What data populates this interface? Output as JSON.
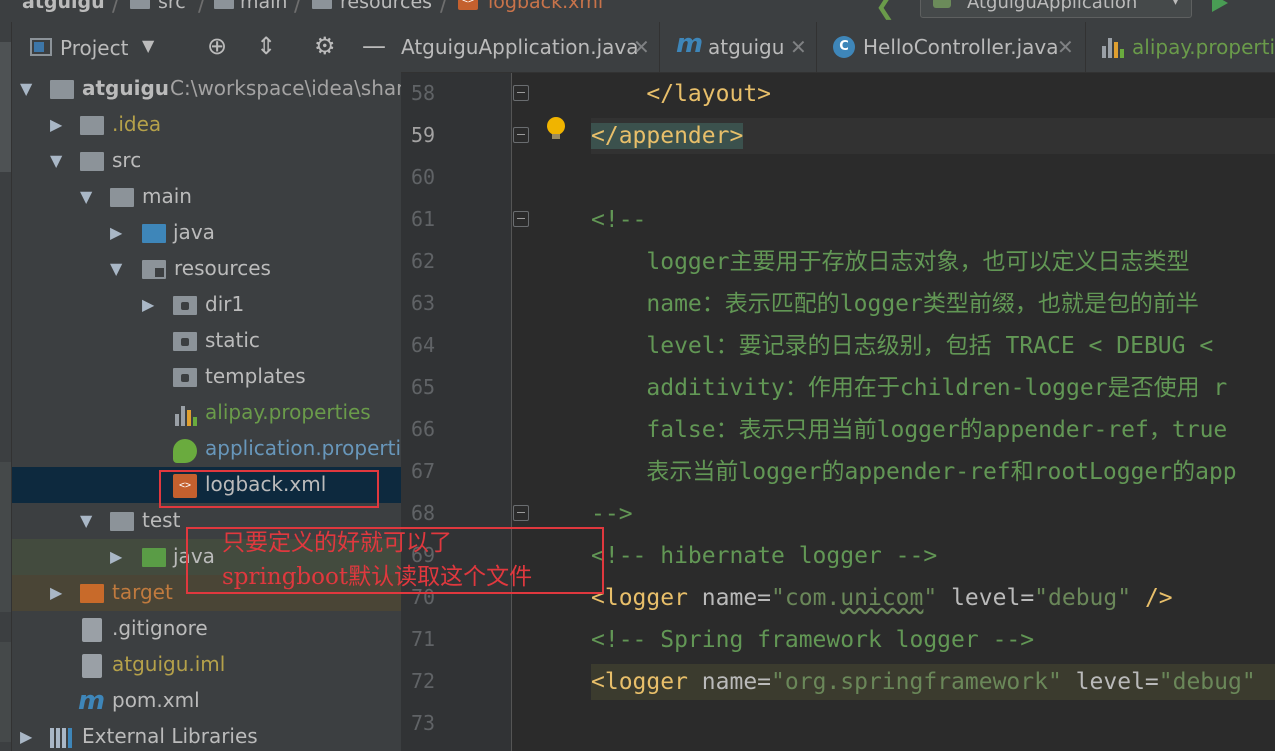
{
  "breadcrumb": {
    "project": "atguigu",
    "src": "src",
    "main": "main",
    "resources": "resources",
    "file": "logback.xml"
  },
  "run_config": {
    "label": "AtguiguApplication"
  },
  "project_panel": {
    "title": "Project",
    "tree": [
      {
        "label": "atguigu",
        "path": "C:\\workspace\\idea\\shang"
      },
      {
        "label": ".idea"
      },
      {
        "label": "src"
      },
      {
        "label": "main"
      },
      {
        "label": "java"
      },
      {
        "label": "resources"
      },
      {
        "label": "dir1"
      },
      {
        "label": "static"
      },
      {
        "label": "templates"
      },
      {
        "label": "alipay.properties"
      },
      {
        "label": "application.propertie"
      },
      {
        "label": "logback.xml"
      },
      {
        "label": "test"
      },
      {
        "label": "java"
      },
      {
        "label": "target"
      },
      {
        "label": ".gitignore"
      },
      {
        "label": "atguigu.iml"
      },
      {
        "label": "pom.xml"
      },
      {
        "label": "External Libraries"
      }
    ]
  },
  "editor_tabs": [
    {
      "label": "AtguiguApplication.java"
    },
    {
      "label": "atguigu"
    },
    {
      "label": "HelloController.java"
    },
    {
      "label": "alipay.propertie"
    }
  ],
  "editor": {
    "lines": [
      {
        "no": "58",
        "text": "    </layout>"
      },
      {
        "no": "59",
        "text": "</appender>"
      },
      {
        "no": "60",
        "text": ""
      },
      {
        "no": "61",
        "text": "<!--"
      },
      {
        "no": "62",
        "text": "    logger主要用于存放日志对象，也可以定义日志类型"
      },
      {
        "no": "63",
        "text": "    name：表示匹配的logger类型前缀，也就是包的前半"
      },
      {
        "no": "64",
        "text": "    level：要记录的日志级别，包括 TRACE < DEBUG <"
      },
      {
        "no": "65",
        "text": "    additivity：作用在于children-logger是否使用 r"
      },
      {
        "no": "66",
        "text": "    false：表示只用当前logger的appender-ref，true"
      },
      {
        "no": "67",
        "text": "    表示当前logger的appender-ref和rootLogger的app"
      },
      {
        "no": "68",
        "text": "-->"
      },
      {
        "no": "69",
        "text": "<!-- hibernate logger -->"
      },
      {
        "no": "70",
        "text": ""
      },
      {
        "no": "71",
        "text": "<!-- Spring framework logger -->"
      },
      {
        "no": "72",
        "text": ""
      },
      {
        "no": "73",
        "text": ""
      }
    ],
    "line70": {
      "open": "<logger",
      "name_attr": " name=",
      "name_val": "\"com.",
      "name_val_wave": "unicom",
      "name_val_end": "\"",
      "level_attr": " level=",
      "level_val": "\"debug\"",
      "close": " />"
    },
    "line72": {
      "open": "<logger",
      "name_attr": " name=",
      "name_val": "\"org.springframework\"",
      "level_attr": " level=",
      "level_val": "\"debug\""
    }
  },
  "annotation": {
    "line1": "只要定义的好就可以了",
    "line2": "springboot默认读取这个文件"
  },
  "colors": {
    "annotation_red": "#e0383e",
    "xml_tag": "#e8bf6a",
    "comment": "#629755",
    "string": "#6a8759"
  }
}
